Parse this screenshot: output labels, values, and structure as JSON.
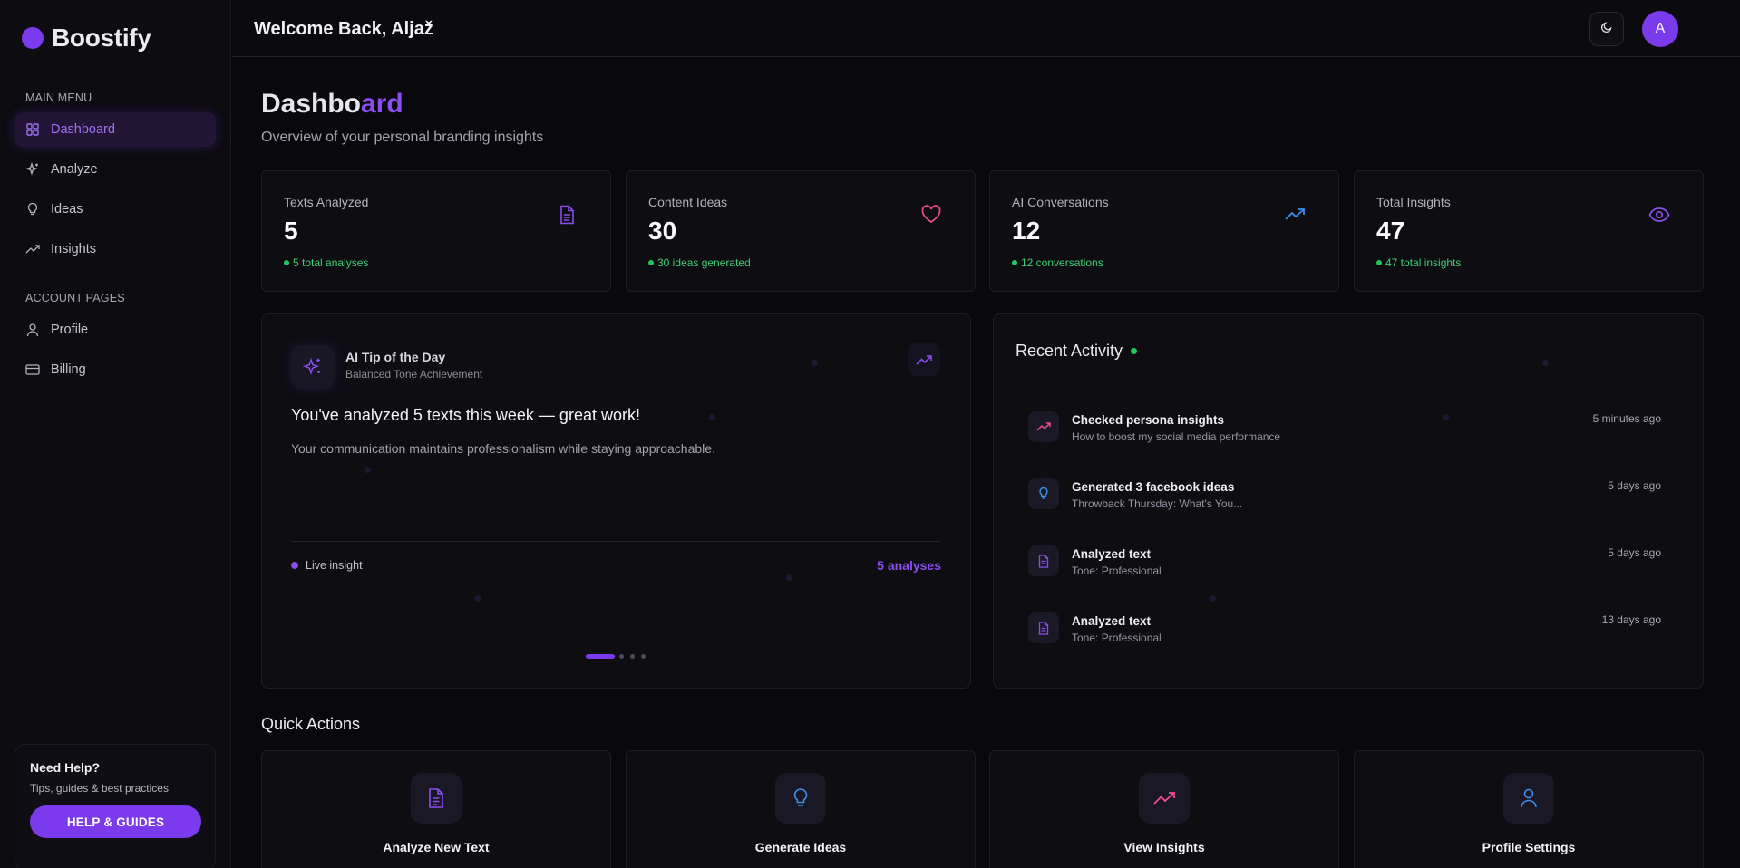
{
  "app": {
    "name": "Boostify"
  },
  "header": {
    "welcome": "Welcome Back, Aljaž",
    "avatar_initial": "A"
  },
  "sidebar": {
    "main_menu_label": "MAIN MENU",
    "main_items": [
      {
        "label": "Dashboard",
        "icon": "grid-icon",
        "active": true
      },
      {
        "label": "Analyze",
        "icon": "sparkle-icon"
      },
      {
        "label": "Ideas",
        "icon": "lightbulb-icon"
      },
      {
        "label": "Insights",
        "icon": "trend-icon"
      }
    ],
    "account_label": "ACCOUNT PAGES",
    "account_items": [
      {
        "label": "Profile",
        "icon": "user-icon"
      },
      {
        "label": "Billing",
        "icon": "card-icon"
      }
    ],
    "help": {
      "title": "Need Help?",
      "subtitle": "Tips, guides & best practices",
      "button": "HELP & GUIDES"
    }
  },
  "page": {
    "title_part1": "Dashbo",
    "title_part2": "ard",
    "subtitle": "Overview of your personal branding insights"
  },
  "stats": [
    {
      "label": "Texts Analyzed",
      "value": "5",
      "note": "5 total analyses",
      "icon": "document-icon",
      "color": "#8b4cf0"
    },
    {
      "label": "Content Ideas",
      "value": "30",
      "note": "30 ideas generated",
      "icon": "heart-icon",
      "color": "#ec4f8f"
    },
    {
      "label": "AI Conversations",
      "value": "12",
      "note": "12 conversations",
      "icon": "trend-up-icon",
      "color": "#3b8eea"
    },
    {
      "label": "Total Insights",
      "value": "47",
      "note": "47 total insights",
      "icon": "eye-icon",
      "color": "#8b4cf0"
    }
  ],
  "tip": {
    "title": "AI Tip of the Day",
    "subtitle": "Balanced Tone Achievement",
    "headline": "You've analyzed 5 texts this week — great work!",
    "body": "Your communication maintains professionalism while staying approachable.",
    "live_label": "Live insight",
    "count_label": "5 analyses"
  },
  "activity": {
    "title": "Recent Activity",
    "items": [
      {
        "title": "Checked persona insights",
        "desc": "How to boost my social media performance",
        "time": "5 minutes ago",
        "icon": "trend-icon"
      },
      {
        "title": "Generated 3 facebook ideas",
        "desc": "Throwback Thursday: What's You...",
        "time": "5 days ago",
        "icon": "lightbulb-icon"
      },
      {
        "title": "Analyzed text",
        "desc": "Tone: Professional",
        "time": "5 days ago",
        "icon": "document-icon"
      },
      {
        "title": "Analyzed text",
        "desc": "Tone: Professional",
        "time": "13 days ago",
        "icon": "document-icon"
      }
    ]
  },
  "quick_actions": {
    "title": "Quick Actions",
    "items": [
      {
        "label": "Analyze New Text",
        "icon": "document-icon"
      },
      {
        "label": "Generate Ideas",
        "icon": "lightbulb-icon"
      },
      {
        "label": "View Insights",
        "icon": "trend-icon"
      },
      {
        "label": "Profile Settings",
        "icon": "user-icon"
      }
    ]
  },
  "colors": {
    "accent": "#7c3aed",
    "success": "#22c55e",
    "background": "#09080c"
  }
}
